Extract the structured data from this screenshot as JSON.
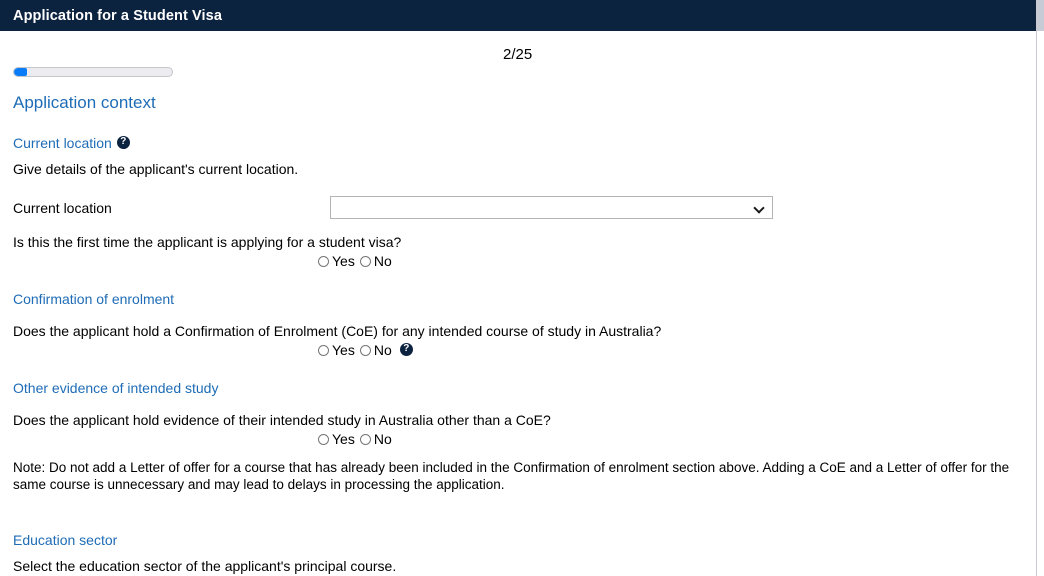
{
  "titlebar": {
    "title": "Application for a Student Visa"
  },
  "progress": {
    "page_counter": "2/25",
    "percent": 8
  },
  "main": {
    "section_heading": "Application context",
    "current_location": {
      "heading": "Current location",
      "help_icon": "help-question-icon",
      "description": "Give details of the applicant's current location.",
      "field_label": "Current location",
      "select_value": "",
      "select_chevron": "chevron-down-icon",
      "first_time_question": "Is this the first time the applicant is applying for a student visa?",
      "radio_yes": "Yes",
      "radio_no": "No"
    },
    "confirmation_of_enrolment": {
      "heading": "Confirmation of enrolment",
      "question": "Does the applicant hold a Confirmation of Enrolment (CoE) for any intended course of study in Australia?",
      "radio_yes": "Yes",
      "radio_no": "No",
      "help_icon": "help-question-icon"
    },
    "other_evidence": {
      "heading": "Other evidence of intended study",
      "question": "Does the applicant hold evidence of their intended study in Australia other than a CoE?",
      "radio_yes": "Yes",
      "radio_no": "No",
      "note": "Note: Do not add a Letter of offer for a course that has already been included in the Confirmation of enrolment section above. Adding a CoE and a Letter of offer for the same course is unnecessary and may lead to delays in processing the application."
    },
    "education_sector": {
      "heading": "Education sector",
      "description": "Select the education sector of the applicant's principal course."
    }
  },
  "colors": {
    "titlebar_bg": "#0c2340",
    "heading_blue": "#1f6cb6",
    "progress_fill": "#0a7cf7",
    "help_icon_bg": "#0c2340"
  }
}
